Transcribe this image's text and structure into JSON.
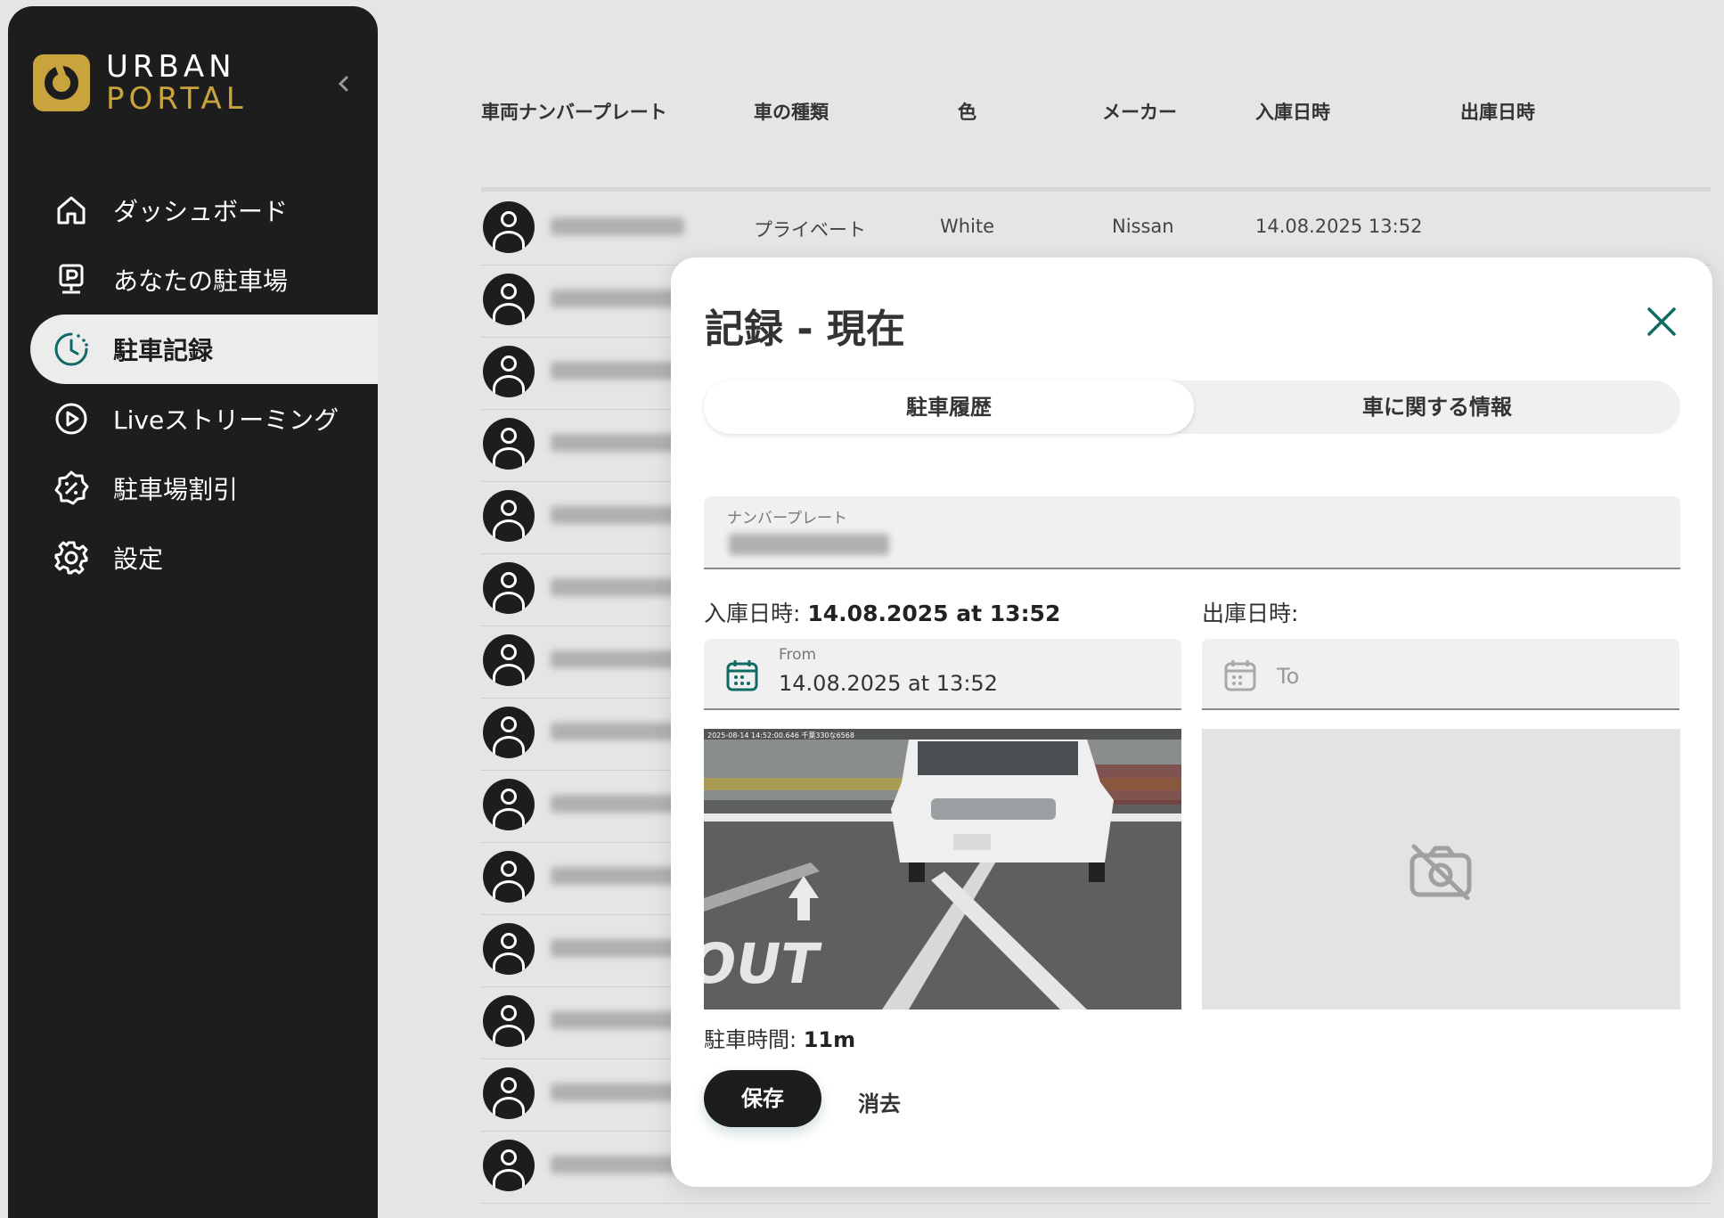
{
  "brand": {
    "line1": "URBAN",
    "line2": "PORTAL",
    "accent": "#c9a43c"
  },
  "sidebar": {
    "items": [
      {
        "label": "ダッシュボード",
        "icon": "home-icon"
      },
      {
        "label": "あなたの駐車場",
        "icon": "parking-sign-icon"
      },
      {
        "label": "駐車記録",
        "icon": "clock-history-icon",
        "active": true
      },
      {
        "label": "Liveストリーミング",
        "icon": "play-circle-icon"
      },
      {
        "label": "駐車場割引",
        "icon": "discount-badge-icon"
      },
      {
        "label": "設定",
        "icon": "gear-icon"
      }
    ]
  },
  "table": {
    "headers": [
      "車両ナンバープレート",
      "車の種類",
      "色",
      "メーカー",
      "入庫日時",
      "出庫日時"
    ],
    "first_row": {
      "type": "プライベート",
      "color": "White",
      "maker": "Nissan",
      "entry": "14.08.2025 13:52"
    }
  },
  "modal": {
    "title": "記録 - 現在",
    "tabs": [
      "駐車履歴",
      "車に関する情報"
    ],
    "plate_label": "ナンバープレート",
    "entry_label": "入庫日時:",
    "entry_value": "14.08.2025 at 13:52",
    "exit_label": "出庫日時:",
    "from_label": "From",
    "from_value": "14.08.2025 at 13:52",
    "to_placeholder": "To",
    "photo_overlay": "2025-08-14 14:52:00.646 千葉330な6568",
    "photo_text": "OUT",
    "duration_label": "駐車時間:",
    "duration_value": "11m",
    "save_label": "保存",
    "clear_label": "消去"
  },
  "colors": {
    "teal": "#0e6b63",
    "dark": "#1d1d1d"
  }
}
